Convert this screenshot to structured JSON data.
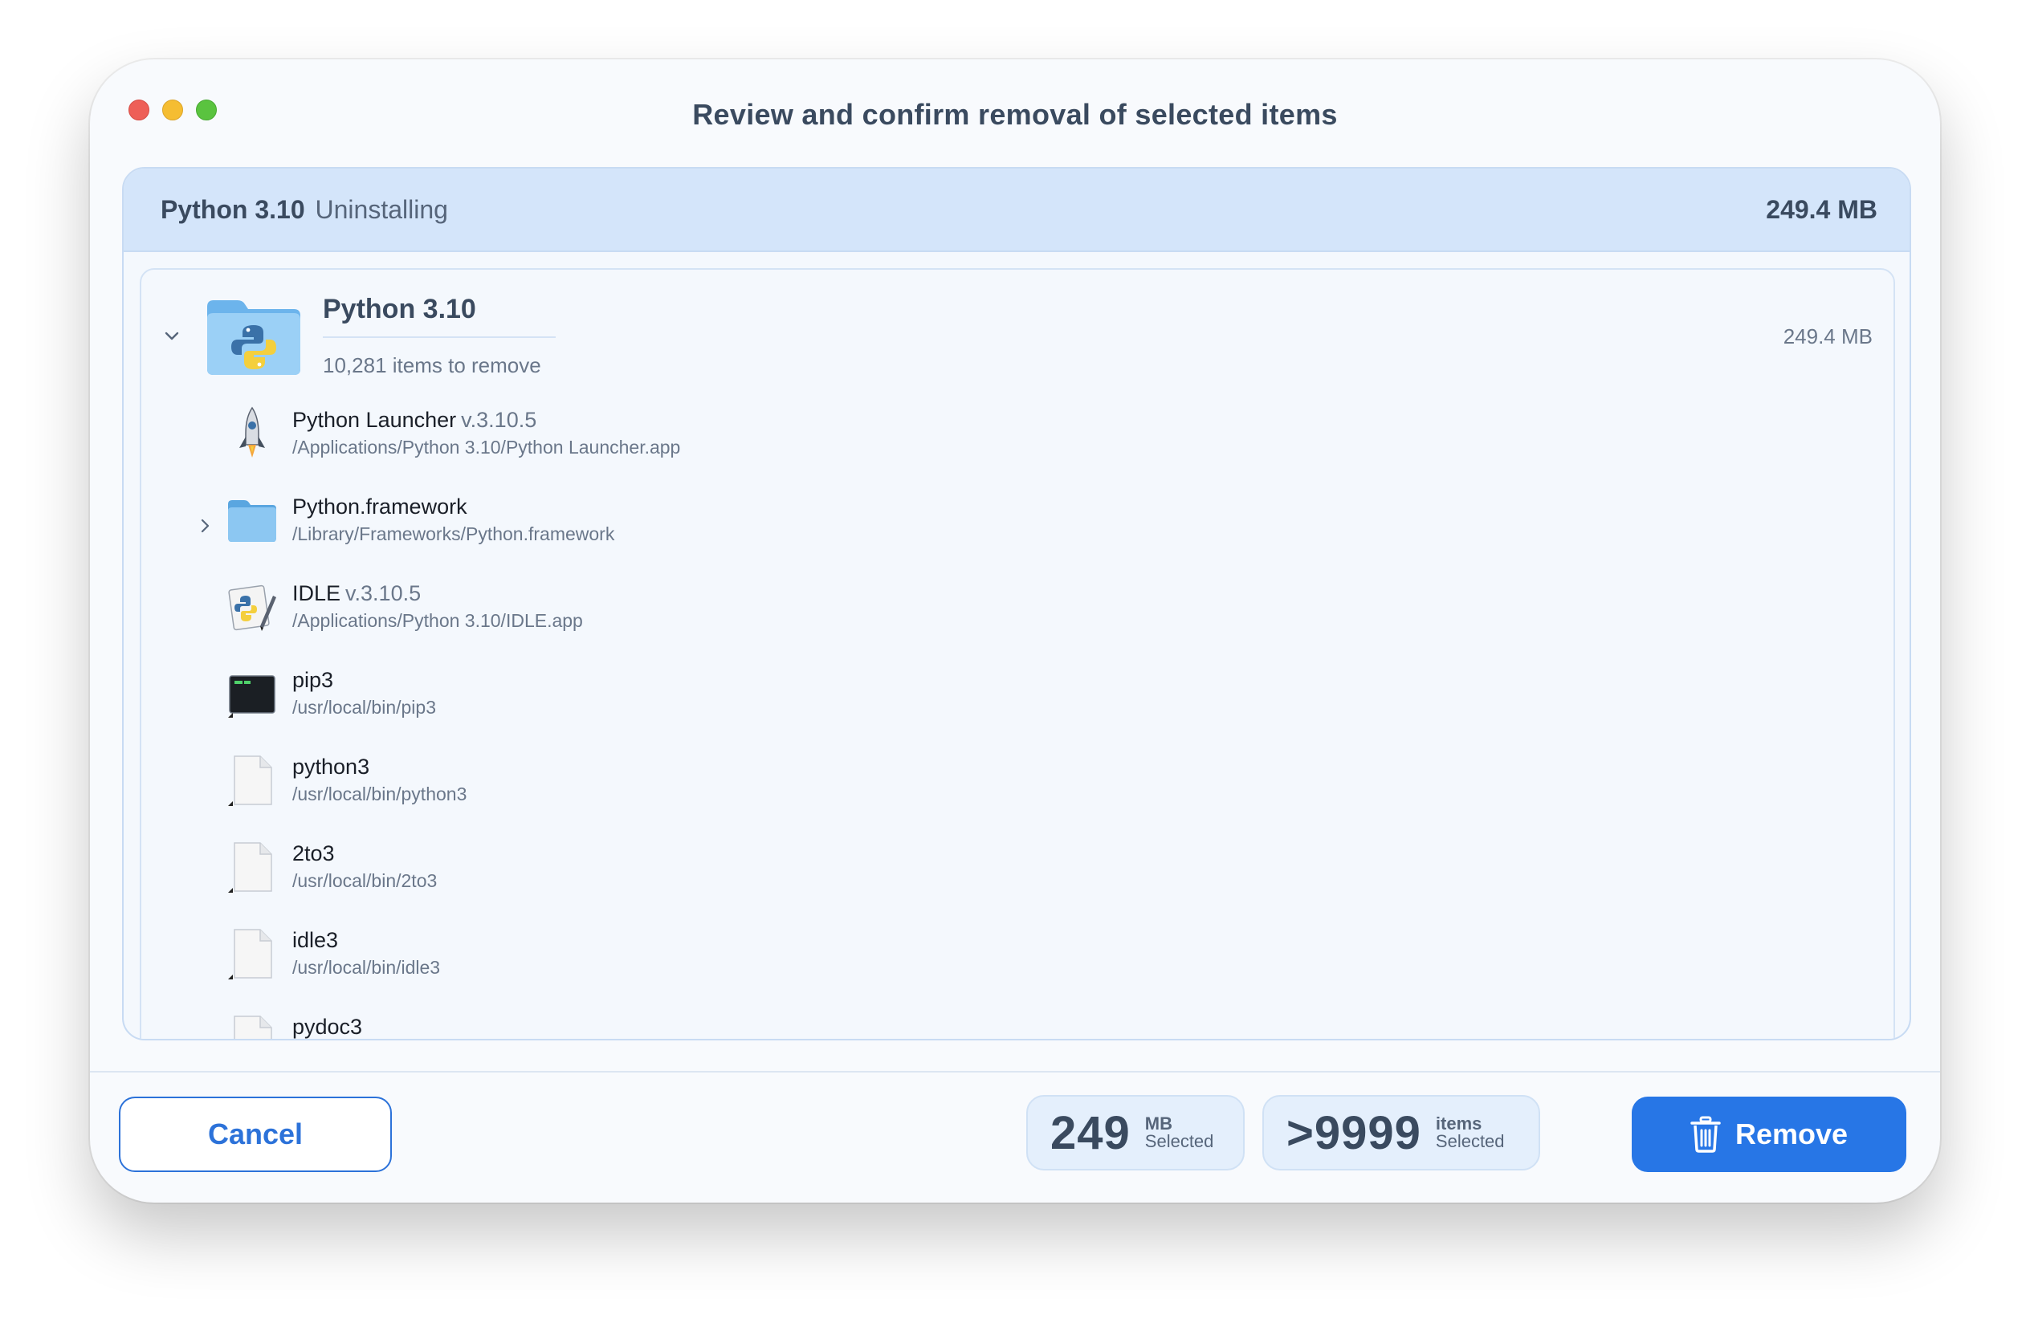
{
  "window": {
    "title": "Review and confirm removal of selected items"
  },
  "panel": {
    "app_name": "Python 3.10",
    "status": "Uninstalling",
    "total_size": "249.4 MB"
  },
  "group": {
    "name": "Python 3.10",
    "subtitle": "10,281 items to remove",
    "size": "249.4 MB",
    "expanded": true,
    "icon": "python-folder-icon"
  },
  "items": [
    {
      "name": "Python Launcher",
      "version": "v.3.10.5",
      "path": "/Applications/Python 3.10/Python Launcher.app",
      "icon": "rocket-icon",
      "expandable": false
    },
    {
      "name": "Python.framework",
      "version": "",
      "path": "/Library/Frameworks/Python.framework",
      "icon": "folder-icon",
      "expandable": true
    },
    {
      "name": "IDLE",
      "version": "v.3.10.5",
      "path": "/Applications/Python 3.10/IDLE.app",
      "icon": "idle-app-icon",
      "expandable": false
    },
    {
      "name": "pip3",
      "version": "",
      "path": "/usr/local/bin/pip3",
      "icon": "terminal-exec-icon",
      "expandable": false
    },
    {
      "name": "python3",
      "version": "",
      "path": "/usr/local/bin/python3",
      "icon": "document-alias-icon",
      "expandable": false
    },
    {
      "name": "2to3",
      "version": "",
      "path": "/usr/local/bin/2to3",
      "icon": "document-alias-icon",
      "expandable": false
    },
    {
      "name": "idle3",
      "version": "",
      "path": "/usr/local/bin/idle3",
      "icon": "document-alias-icon",
      "expandable": false
    },
    {
      "name": "pydoc3",
      "version": "",
      "path": "",
      "icon": "document-alias-icon",
      "expandable": false
    }
  ],
  "footer": {
    "cancel_label": "Cancel",
    "size_selected_value": "249",
    "size_selected_unit": "MB",
    "size_selected_label": "Selected",
    "items_selected_value": ">9999",
    "items_selected_unit": "items",
    "items_selected_label": "Selected",
    "remove_label": "Remove"
  },
  "colors": {
    "accent": "#2776e6",
    "panel_header": "#d4e5fa",
    "stat_bg": "#e4effc"
  }
}
